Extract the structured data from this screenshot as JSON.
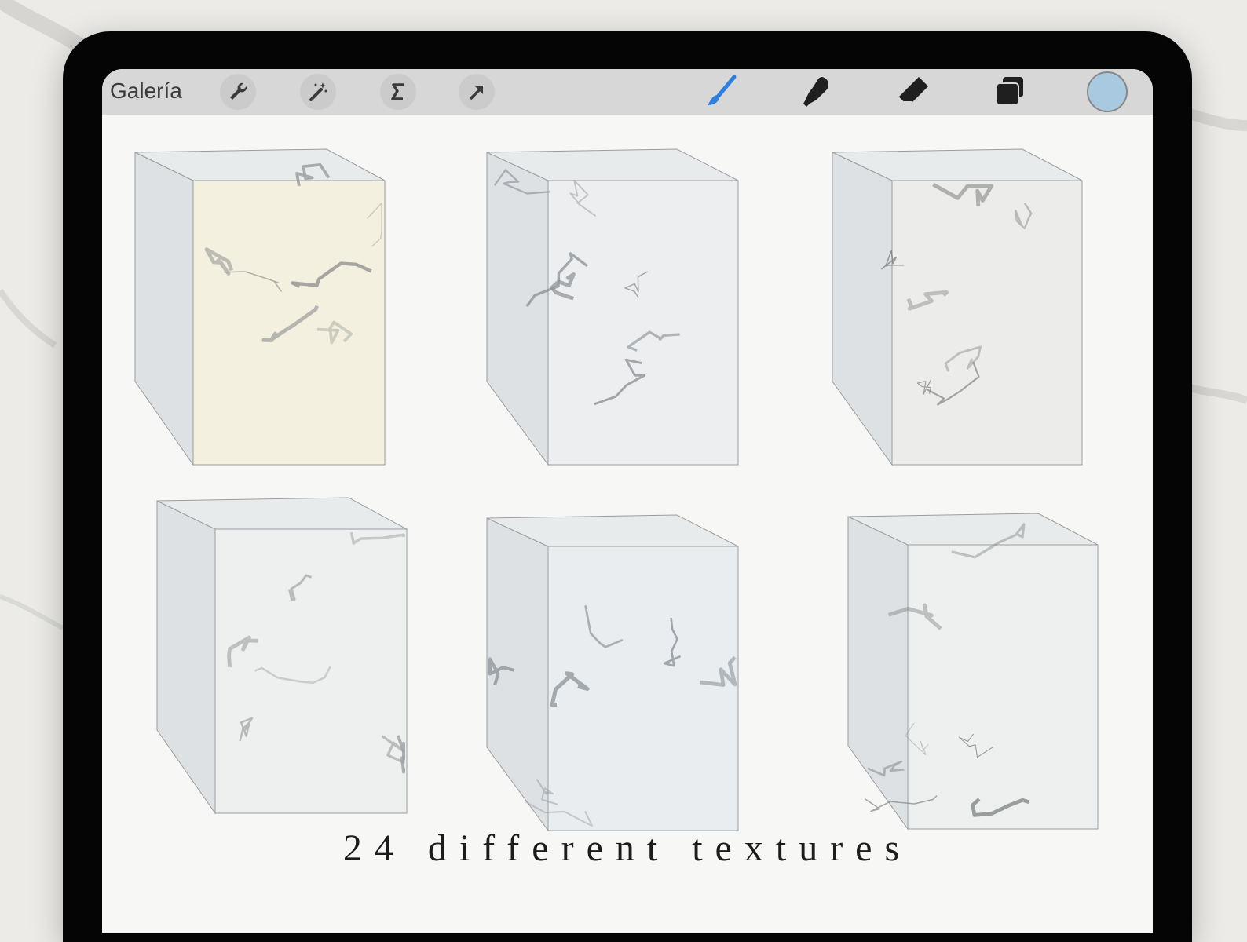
{
  "toolbar": {
    "gallery_label": "Galería",
    "left_tools": [
      {
        "name": "wrench-icon"
      },
      {
        "name": "magic-wand-icon"
      },
      {
        "name": "selection-icon"
      },
      {
        "name": "transform-arrow-icon"
      }
    ],
    "right_tools": [
      {
        "name": "brush-icon",
        "active": true
      },
      {
        "name": "smudge-icon"
      },
      {
        "name": "eraser-icon"
      },
      {
        "name": "layers-icon"
      }
    ],
    "active_color": "#a9c9e0",
    "active_tool_color": "#2d7fe0"
  },
  "caption": "24 different textures",
  "textures": [
    {
      "name": "marble-cube-1",
      "tint": "#f4f0df",
      "vein": "#8f9091"
    },
    {
      "name": "marble-cube-2",
      "tint": "#eceeef",
      "vein": "#8c9095"
    },
    {
      "name": "marble-cube-3",
      "tint": "#ecedeb",
      "vein": "#7b7d7c"
    },
    {
      "name": "marble-cube-4",
      "tint": "#eef0ef",
      "vein": "#9a9c9d"
    },
    {
      "name": "marble-cube-5",
      "tint": "#eaedef",
      "vein": "#8a9096"
    },
    {
      "name": "marble-cube-6",
      "tint": "#eef0f0",
      "vein": "#7e8283"
    }
  ]
}
